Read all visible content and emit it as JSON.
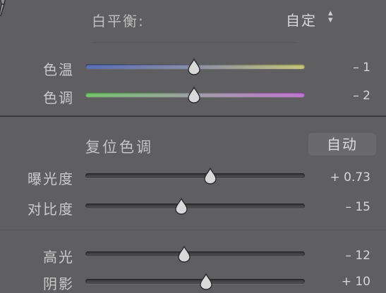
{
  "white_balance": {
    "label": "白平衡:",
    "value": "自定",
    "arrow": "⌃⌄"
  },
  "sliders_wb": [
    {
      "label": "色温",
      "value": "– 1",
      "position": 0.49
    },
    {
      "label": "色调",
      "value": "– 2",
      "position": 0.49
    }
  ],
  "tone": {
    "title": "复位色调",
    "auto_label": "自动"
  },
  "sliders_tone": [
    {
      "label": "曝光度",
      "value": "+ 0.73",
      "position": 0.57
    },
    {
      "label": "对比度",
      "value": "– 15",
      "position": 0.43
    },
    {
      "label": "高光",
      "value": "– 12",
      "position": 0.45
    },
    {
      "label": "阴影",
      "value": "+ 10",
      "position": 0.55
    }
  ],
  "colors": {
    "background": "#5f5f61",
    "separator": "#3a3a3c",
    "text": "#cfcfcf"
  }
}
